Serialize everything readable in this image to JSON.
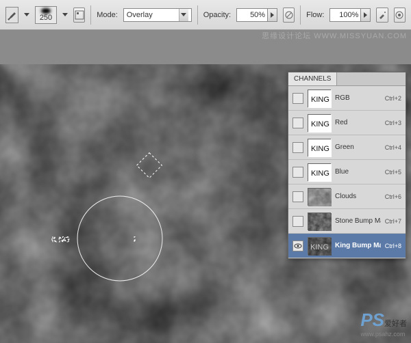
{
  "watermarks": {
    "top_right": "思缘设计论坛  WWW.MISSYUAN.COM",
    "bottom_right_brand": "PS",
    "bottom_right_text": "爱好者",
    "bottom_right_url": "www.psahz.com"
  },
  "options_bar": {
    "brush_size": "250",
    "mode_label": "Mode:",
    "mode_value": "Overlay",
    "opacity_label": "Opacity:",
    "opacity_value": "50%",
    "flow_label": "Flow:",
    "flow_value": "100%"
  },
  "channels_panel": {
    "tab": "CHANNELS",
    "rows": [
      {
        "name": "RGB",
        "short": "Ctrl+2",
        "thumb": "king-white",
        "eye": false,
        "selected": false
      },
      {
        "name": "Red",
        "short": "Ctrl+3",
        "thumb": "king-white",
        "eye": false,
        "selected": false
      },
      {
        "name": "Green",
        "short": "Ctrl+4",
        "thumb": "king-white",
        "eye": false,
        "selected": false
      },
      {
        "name": "Blue",
        "short": "Ctrl+5",
        "thumb": "king-white",
        "eye": false,
        "selected": false
      },
      {
        "name": "Clouds",
        "short": "Ctrl+6",
        "thumb": "clouds",
        "eye": false,
        "selected": false
      },
      {
        "name": "Stone Bump Map",
        "short": "Ctrl+7",
        "thumb": "stone",
        "eye": false,
        "selected": false
      },
      {
        "name": "King Bump Map",
        "short": "Ctrl+8",
        "thumb": "kingbump",
        "eye": true,
        "selected": true
      }
    ]
  },
  "canvas": {
    "text": "KING",
    "accent_dot": "diamond",
    "brush_cursor": "circle"
  }
}
